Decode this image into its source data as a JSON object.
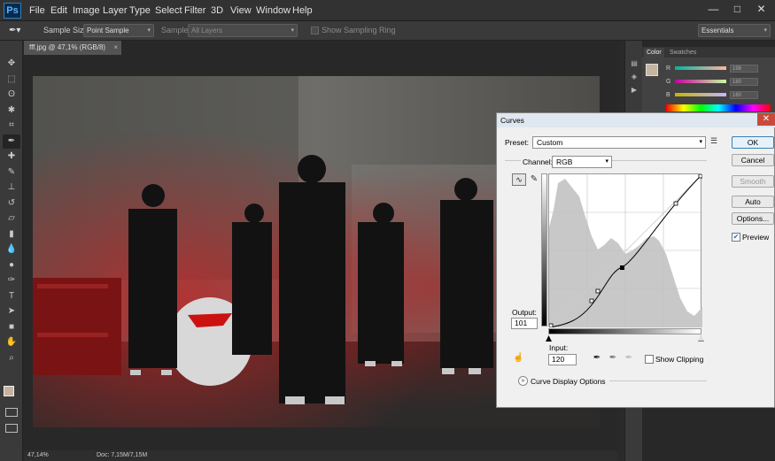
{
  "app": {
    "logo": "Ps"
  },
  "menu": [
    "File",
    "Edit",
    "Image",
    "Layer",
    "Type",
    "Select",
    "Filter",
    "3D",
    "View",
    "Window",
    "Help"
  ],
  "window_controls": {
    "minimize": "—",
    "maximize": "□",
    "close": "✕"
  },
  "options_bar": {
    "tool_icon": "eyedropper-icon",
    "sample_size_label": "Sample Size:",
    "sample_size_value": "Point Sample",
    "sample_label": "Sample:",
    "sample_value": "All Layers",
    "show_sampling_ring": "Show Sampling Ring",
    "workspace": "Essentials"
  },
  "document": {
    "tab_title": "fff.jpg @ 47,1% (RGB/8)",
    "tab_close": "×",
    "zoom": "47,14%",
    "doc_info": "Doc: 7,15M/7,15M"
  },
  "color_panel": {
    "tabs": [
      "Color",
      "Swatches"
    ],
    "channels": [
      {
        "label": "R",
        "value": "198"
      },
      {
        "label": "G",
        "value": "180"
      },
      {
        "label": "B",
        "value": "160"
      }
    ],
    "foreground": "#c6b4a0"
  },
  "curves_dialog": {
    "title": "Curves",
    "close": "✕",
    "preset_label": "Preset:",
    "preset_value": "Custom",
    "channel_label": "Channel:",
    "channel_value": "RGB",
    "output_label": "Output:",
    "output_value": "101",
    "input_label": "Input:",
    "input_value": "120",
    "show_clipping": "Show Clipping",
    "display_options": "Curve Display Options",
    "buttons": {
      "ok": "OK",
      "cancel": "Cancel",
      "smooth": "Smooth",
      "auto": "Auto",
      "options": "Options..."
    },
    "preview_label": "Preview",
    "preview_checked": true
  },
  "tools": [
    "move-icon",
    "marquee-icon",
    "lasso-icon",
    "quick-select-icon",
    "crop-icon",
    "eyedropper-icon",
    "healing-icon",
    "brush-icon",
    "stamp-icon",
    "history-brush-icon",
    "eraser-icon",
    "gradient-icon",
    "blur-icon",
    "dodge-icon",
    "pen-icon",
    "type-icon",
    "path-select-icon",
    "shape-icon",
    "hand-icon",
    "zoom-icon"
  ]
}
